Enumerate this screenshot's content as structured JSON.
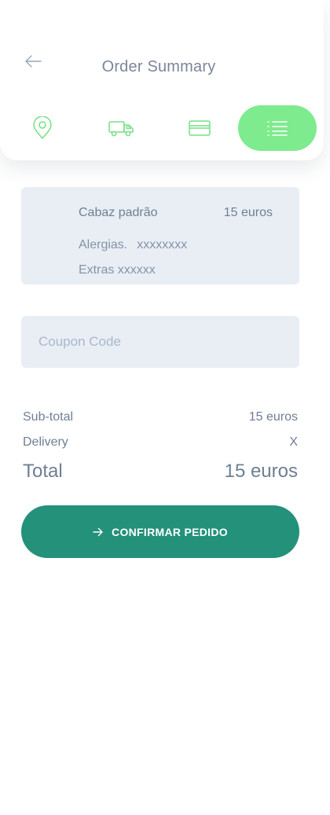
{
  "header": {
    "title": "Order Summary",
    "back_icon": "arrow-left-icon",
    "steps": [
      {
        "icon": "location-pin-icon",
        "active": false
      },
      {
        "icon": "truck-icon",
        "active": false
      },
      {
        "icon": "credit-card-icon",
        "active": false
      },
      {
        "icon": "list-icon",
        "active": true
      }
    ]
  },
  "basket": {
    "name": "Cabaz padrão",
    "price": "15 euros",
    "allergies_label": "Alergias.",
    "allergies_value": "xxxxxxxx",
    "extras": "Extras xxxxxx"
  },
  "coupon": {
    "placeholder": "Coupon Code",
    "value": ""
  },
  "totals": {
    "subtotal_label": "Sub-total",
    "subtotal_value": "15 euros",
    "delivery_label": "Delivery",
    "delivery_value": "X",
    "total_label": "Total",
    "total_value": "15 euros"
  },
  "confirm": {
    "label": "CONFIRMAR PEDIDO",
    "icon": "arrow-right-icon"
  },
  "colors": {
    "accent_green": "#7eeb8e",
    "icon_green": "#74e086",
    "button_teal": "#24917a",
    "card_bg": "#e9eef5",
    "text": "#6e7f95"
  }
}
